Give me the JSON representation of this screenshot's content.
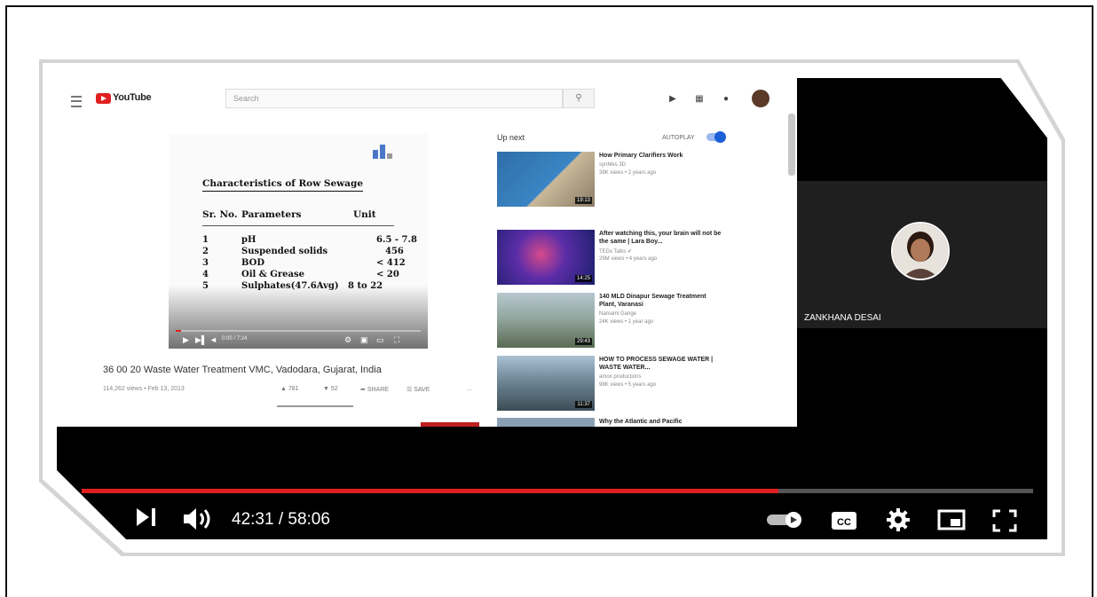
{
  "youtube": {
    "logo_text": "YouTube",
    "search_placeholder": "Search",
    "slide": {
      "title": "Characteristics of Row Sewage",
      "headers": [
        "Sr. No.",
        "Parameters",
        "Unit"
      ],
      "rows": [
        {
          "no": "1",
          "param": "pH",
          "unit": "6.5 - 7.8"
        },
        {
          "no": "2",
          "param": "Suspended solids",
          "unit": "456"
        },
        {
          "no": "3",
          "param": "BOD",
          "unit": "< 412"
        },
        {
          "no": "4",
          "param": "Oil & Grease",
          "unit": "< 20"
        },
        {
          "no": "5",
          "param": "Sulphates(47.6Avg)",
          "unit": "8 to 22"
        }
      ]
    },
    "video_time": "0:00 / 7:24",
    "video_progress": 0.02,
    "video_title": "36 00 20 Waste Water Treatment VMC, Vadodara, Gujarat, India",
    "video_meta": "114,262 views • Feb 13, 2013",
    "actions": {
      "likes": "781",
      "dislikes": "52",
      "share": "SHARE",
      "save": "SAVE",
      "more": "..."
    },
    "up_next": "Up next",
    "autoplay": "AUTOPLAY",
    "recommendations": [
      {
        "title": "How Primary Clarifiers Work",
        "channel": "synMes 3D",
        "meta": "38K views • 2 years ago",
        "duration": "19:13"
      },
      {
        "title": "After watching this, your brain will not be the same | Lara Boy...",
        "channel": "TEDx Talks",
        "meta": "29M views • 4 years ago",
        "duration": "14:25"
      },
      {
        "title": "140 MLD Dinapur Sewage Treatment Plant, Varanasi",
        "channel": "Namami Gange",
        "meta": "24K views • 1 year ago",
        "duration": "29:43"
      },
      {
        "title": "HOW TO PROCESS SEWAGE WATER | WASTE WATER...",
        "channel": "amox productions",
        "meta": "98K views • 5 years ago",
        "duration": "11:37"
      },
      {
        "title": "Why the Atlantic and Pacific",
        "channel": "",
        "meta": "",
        "duration": ""
      }
    ]
  },
  "participant": {
    "name": "ZANKHANA DESAI"
  },
  "player": {
    "time": "42:31 / 58:06",
    "progress": 0.732
  },
  "colors": {
    "accent": "#e02020",
    "toggle": "#1a5fd6"
  }
}
